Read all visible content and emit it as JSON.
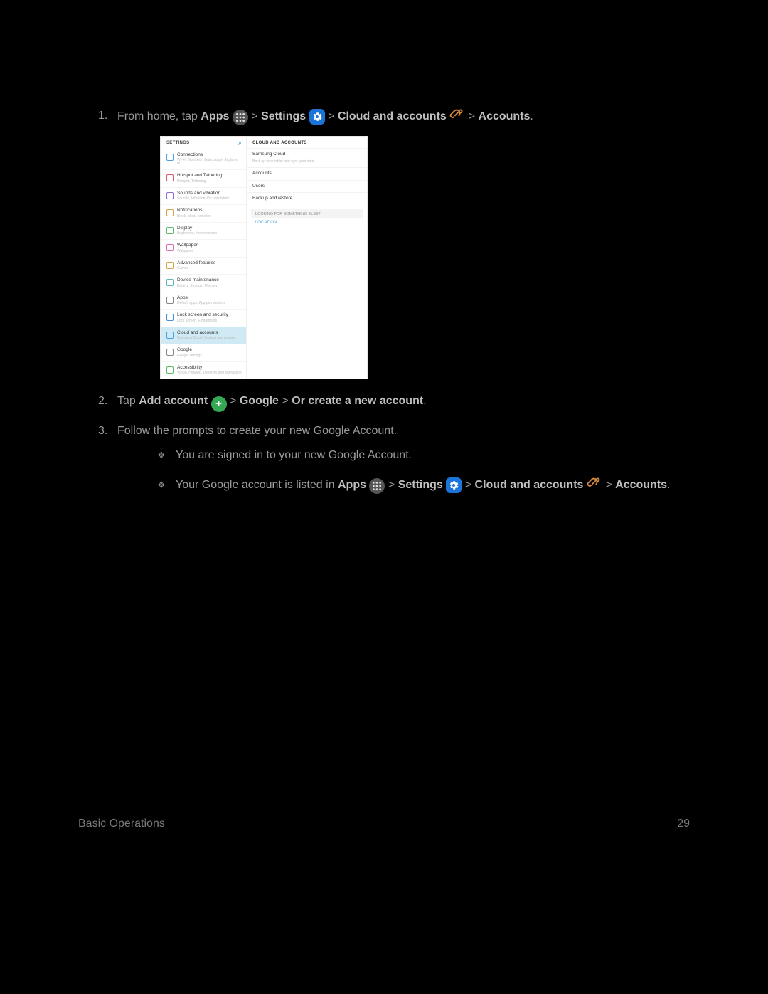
{
  "step1": {
    "prefix": "From home, tap ",
    "apps": "Apps",
    "sep": " > ",
    "settings": "Settings",
    "cloud": "Cloud and accounts",
    "accounts": "Accounts",
    "period": "."
  },
  "screenshot": {
    "left_header": "SETTINGS",
    "right_header": "CLOUD AND ACCOUNTS",
    "left_items": [
      {
        "title": "Connections",
        "sub": "Wi-Fi, Bluetooth, Data usage, Airplane m…",
        "color": "#4aa3e0"
      },
      {
        "title": "Hotspot and Tethering",
        "sub": "Hotspot, Tethering",
        "color": "#d65a6b"
      },
      {
        "title": "Sounds and vibration",
        "sub": "Sounds, Vibration, Do not disturb",
        "color": "#8e6bd6"
      },
      {
        "title": "Notifications",
        "sub": "Block, allow, prioritize",
        "color": "#d6a24a"
      },
      {
        "title": "Display",
        "sub": "Brightness, Home screen",
        "color": "#5bb96a"
      },
      {
        "title": "Wallpaper",
        "sub": "Wallpaper",
        "color": "#d66bb0"
      },
      {
        "title": "Advanced features",
        "sub": "Games",
        "color": "#d6a24a"
      },
      {
        "title": "Device maintenance",
        "sub": "Battery, Storage, Memory",
        "color": "#5bb9b9"
      },
      {
        "title": "Apps",
        "sub": "Default apps, App permissions",
        "color": "#888"
      },
      {
        "title": "Lock screen and security",
        "sub": "Lock screen, Fingerprints",
        "color": "#4a8ed6"
      },
      {
        "title": "Cloud and accounts",
        "sub": "Samsung Cloud, Backup and restore",
        "color": "#4aa3e0",
        "selected": true
      },
      {
        "title": "Google",
        "sub": "Google settings",
        "color": "#888"
      },
      {
        "title": "Accessibility",
        "sub": "Vision, Hearing, Dexterity and interaction",
        "color": "#5bb96a"
      }
    ],
    "right_items": {
      "samsung_cloud": "Samsung Cloud",
      "samsung_cloud_sub": "Back up your tablet and sync your data.",
      "accounts": "Accounts",
      "users": "Users",
      "backup": "Backup and restore",
      "looking": "LOOKING FOR SOMETHING ELSE?",
      "location": "LOCATION"
    }
  },
  "step2": {
    "prefix": "Tap ",
    "add": "Add account",
    "sep": " > ",
    "google": "Google",
    "or": "Or create a new account",
    "period": "."
  },
  "step3": {
    "text": "Follow the prompts to create your new Google Account.",
    "sub1": "You are signed in to your new Google Account.",
    "sub2_prefix": "Your Google account is listed in ",
    "apps": "Apps",
    "sep": " > ",
    "settings": "Settings",
    "cloud": "Cloud and accounts",
    "accounts": "Accounts",
    "period": "."
  },
  "footer": {
    "section": "Basic Operations",
    "page": "29"
  }
}
